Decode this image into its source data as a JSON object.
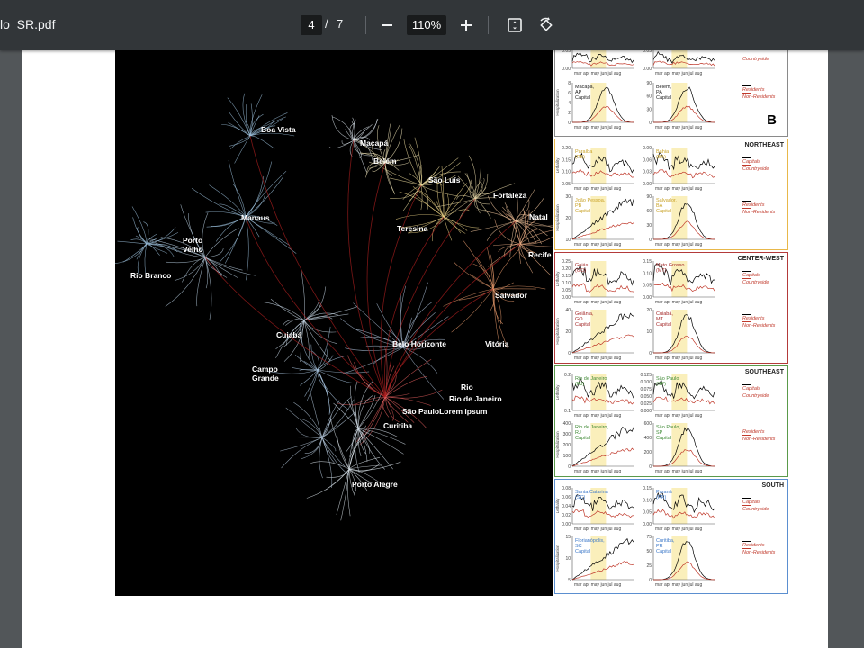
{
  "toolbar": {
    "file_title": "lo_SR.pdf",
    "current_page": "4",
    "page_separator": "/",
    "total_pages": "7",
    "zoom_level": "110%",
    "icons": [
      "minus-icon",
      "plus-icon",
      "fit-page-icon",
      "rotate-icon"
    ]
  },
  "colors": {
    "toolbar_bg": "#323639",
    "viewer_bg": "#525659",
    "northeast": "#e8b84a",
    "center_west": "#b33a3a",
    "southeast": "#5a9a4a",
    "south": "#5b8fd0",
    "north": "#7a7a7a"
  },
  "map": {
    "cities": [
      "Boa Vista",
      "Macapá",
      "Belém",
      "São Luís",
      "Fortaleza",
      "Manaus",
      "Teresina",
      "Natal",
      "Porto\nVelho",
      "Recife",
      "Rio Branco",
      "Salvador",
      "Cuiabá",
      "Belo Horizonte",
      "Vitória",
      "Campo\nGrande",
      "Rio",
      "Rio de Janeiro",
      "São PauloLorem ipsum",
      "Curitiba",
      "Porto Alegre"
    ]
  },
  "panel_b": {
    "label": "B",
    "month_ticks": "mar apr may jun jul aug",
    "lethality_label": "Lethality",
    "hosp_label": "Hospitalization",
    "legend_capitals": "Capitals",
    "legend_countryside": "Countryside",
    "legend_residents": "Residents",
    "legend_nonresidents": "Non-Residents",
    "north": {
      "y_ticks_top": [
        "0.05",
        "0.00"
      ],
      "y_ticks_top_right": [
        "0.05",
        "0.00"
      ],
      "city_left": "Macapá,\nAP\nCapital",
      "y_ticks_left": [
        "8",
        "6",
        "4",
        "2",
        "0"
      ],
      "city_right": "Belém,\nPA\nCapital",
      "y_ticks_right": [
        "90",
        "60",
        "30",
        "0"
      ]
    },
    "northeast": {
      "title": "NORTHEAST",
      "state_left": "Paraíba\n(PB)",
      "y_ticks_leth_left": [
        "0.20",
        "0.15",
        "0.10",
        "0.05"
      ],
      "state_right": "Bahia\n(BA)",
      "y_ticks_leth_right": [
        "0.09",
        "0.06",
        "0.03",
        "0.00"
      ],
      "city_left": "João Pessoa,\nPB\nCapital",
      "y_ticks_hosp_left": [
        "30",
        "20",
        "10"
      ],
      "city_right": "Salvador,\nBA\nCapital",
      "y_ticks_hosp_right": [
        "90",
        "60",
        "30",
        "0"
      ]
    },
    "center_west": {
      "title": "CENTER-WEST",
      "state_left": "Goiás\n(GO)",
      "y_ticks_leth_left": [
        "0.25",
        "0.20",
        "0.15",
        "0.10",
        "0.05",
        "0.00"
      ],
      "state_right": "Mato Grosso\n(MT)",
      "y_ticks_leth_right": [
        "0.15",
        "0.10",
        "0.05",
        "0.00"
      ],
      "city_left": "Goiânia,\nGO\nCapital",
      "y_ticks_hosp_left": [
        "40",
        "20",
        "0"
      ],
      "city_right": "Cuiabá,\nMT\nCapital",
      "y_ticks_hosp_right": [
        "20",
        "10",
        "0"
      ]
    },
    "southeast": {
      "title": "SOUTHEAST",
      "state_left": "Rio de Janeiro\n(RJ)",
      "y_ticks_leth_left": [
        "0.2",
        "0.1"
      ],
      "state_right": "São Paulo\n(SP)",
      "y_ticks_leth_right": [
        "0.125",
        "0.100",
        "0.075",
        "0.050",
        "0.025",
        "0.000"
      ],
      "city_left": "Rio de Janeiro,\nRJ\nCapital",
      "y_ticks_hosp_left": [
        "400",
        "300",
        "200",
        "100",
        "0"
      ],
      "city_right": "São Paulo,\nSP\nCapital",
      "y_ticks_hosp_right": [
        "600",
        "400",
        "200",
        "0"
      ]
    },
    "south": {
      "title": "SOUTH",
      "state_left": "Santa Catarina\n(SC)",
      "y_ticks_leth_left": [
        "0.08",
        "0.06",
        "0.04",
        "0.02",
        "0.00"
      ],
      "state_right": "Paraná\n(PR)",
      "y_ticks_leth_right": [
        "0.15",
        "0.10",
        "0.05",
        "0.00"
      ],
      "city_left": "Florianópolis,\nSC\nCapital",
      "y_ticks_hosp_left": [
        "15",
        "10",
        "5"
      ],
      "city_right": "Curitiba,\nPR\nCapital",
      "y_ticks_hosp_right": [
        "75",
        "50",
        "25",
        "0"
      ]
    }
  }
}
